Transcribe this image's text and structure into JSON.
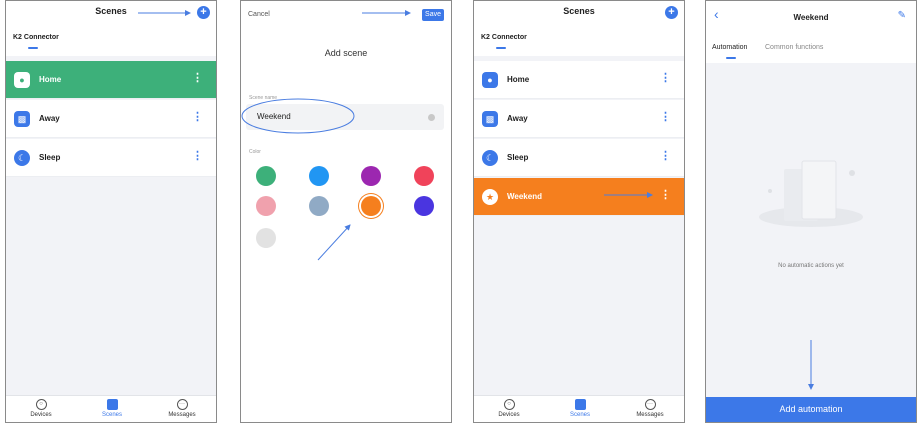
{
  "panel1": {
    "title": "Scenes",
    "hub_tab": "K2 Connector",
    "scenes": [
      {
        "label": "Home",
        "icon": "home-person-icon",
        "color": "#3db07a"
      },
      {
        "label": "Away",
        "icon": "briefcase-icon"
      },
      {
        "label": "Sleep",
        "icon": "moon-icon"
      }
    ]
  },
  "panel2": {
    "cancel": "Cancel",
    "save": "Save",
    "title": "Add scene",
    "scene_name_label": "Scene name",
    "scene_name_value": "Weekend",
    "color_label": "Color",
    "colors": [
      "#3db07a",
      "#2196f3",
      "#9c27b0",
      "#f0435a",
      "#f0a1ad",
      "#90aac5",
      "#f57f1e",
      "#4a35e0",
      "#e2e2e2"
    ],
    "selected_color": "#f57f1e"
  },
  "panel3": {
    "title": "Scenes",
    "hub_tab": "K2 Connector",
    "scenes": [
      {
        "label": "Home",
        "icon": "home-person-icon"
      },
      {
        "label": "Away",
        "icon": "briefcase-icon"
      },
      {
        "label": "Sleep",
        "icon": "moon-icon"
      },
      {
        "label": "Weekend",
        "icon": "star-badge-icon",
        "color": "#f57f1e"
      }
    ]
  },
  "panel4": {
    "title": "Weekend",
    "tabs": [
      "Automation",
      "Common functions"
    ],
    "empty_text": "No automatic actions yet",
    "add_button": "Add automation"
  },
  "nav": [
    {
      "label": "Devices",
      "icon": "devices-icon"
    },
    {
      "label": "Scenes",
      "icon": "scenes-icon",
      "active": true
    },
    {
      "label": "Messages",
      "icon": "messages-icon"
    }
  ],
  "colors": {
    "accent": "#3c78e8",
    "green": "#3db07a",
    "orange": "#f57f1e"
  }
}
